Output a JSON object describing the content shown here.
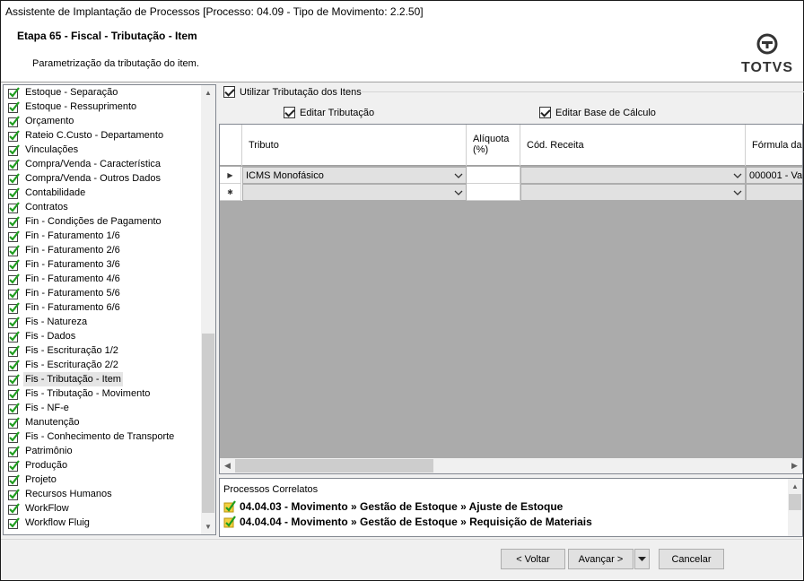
{
  "window": {
    "title": "Assistente de Implantação de Processos [Processo: 04.09 - Tipo de Movimento: 2.2.50]"
  },
  "header": {
    "step_title": "Etapa 65 - Fiscal - Tributação - Item",
    "step_description": "Parametrização da tributação do item.",
    "logo_text": "TOTVS"
  },
  "sidebar": {
    "items": [
      {
        "label": "Estoque - Separação"
      },
      {
        "label": "Estoque - Ressuprimento"
      },
      {
        "label": "Orçamento"
      },
      {
        "label": "Rateio C.Custo - Departamento"
      },
      {
        "label": "Vinculações"
      },
      {
        "label": "Compra/Venda - Característica"
      },
      {
        "label": "Compra/Venda - Outros Dados"
      },
      {
        "label": "Contabilidade"
      },
      {
        "label": "Contratos"
      },
      {
        "label": "Fin - Condições de Pagamento"
      },
      {
        "label": "Fin - Faturamento 1/6"
      },
      {
        "label": "Fin - Faturamento 2/6"
      },
      {
        "label": "Fin - Faturamento 3/6"
      },
      {
        "label": "Fin - Faturamento 4/6"
      },
      {
        "label": "Fin - Faturamento 5/6"
      },
      {
        "label": "Fin - Faturamento 6/6"
      },
      {
        "label": "Fis - Natureza"
      },
      {
        "label": "Fis - Dados"
      },
      {
        "label": "Fis - Escrituração 1/2"
      },
      {
        "label": "Fis - Escrituração 2/2"
      },
      {
        "label": "Fis - Tributação - Item"
      },
      {
        "label": "Fis - Tributação - Movimento"
      },
      {
        "label": "Fis - NF-e"
      },
      {
        "label": "Manutenção"
      },
      {
        "label": "Fis - Conhecimento de Transporte"
      },
      {
        "label": "Patrimônio"
      },
      {
        "label": "Produção"
      },
      {
        "label": "Projeto"
      },
      {
        "label": "Recursos Humanos"
      },
      {
        "label": "WorkFlow"
      },
      {
        "label": "Workflow Fluig"
      }
    ],
    "selected_index": 20
  },
  "options": {
    "use_item_tax": "Utilizar Tributação dos Itens",
    "edit_tax": "Editar Tributação",
    "edit_base": "Editar Base de Cálculo"
  },
  "grid": {
    "columns": {
      "tributo": "Tributo",
      "aliquota": "Alíquota (%)",
      "cod_receita": "Cód. Receita",
      "formula": "Fórmula da"
    },
    "rows": [
      {
        "tributo": "ICMS Monofásico",
        "aliquota": "",
        "cod_receita": "",
        "formula": "000001 - Val"
      },
      {
        "tributo": "",
        "aliquota": "",
        "cod_receita": "",
        "formula": ""
      }
    ]
  },
  "related": {
    "title": "Processos Correlatos",
    "items": [
      "04.04.03 - Movimento » Gestão de Estoque » Ajuste de Estoque",
      "04.04.04 - Movimento » Gestão de Estoque » Requisição de Materiais"
    ]
  },
  "footer": {
    "back": "< Voltar",
    "next": "Avançar >",
    "cancel": "Cancelar"
  },
  "colors": {
    "check_green": "#1f9d1f",
    "selection": "#e5e5e5",
    "grid_empty": "#ababab"
  }
}
